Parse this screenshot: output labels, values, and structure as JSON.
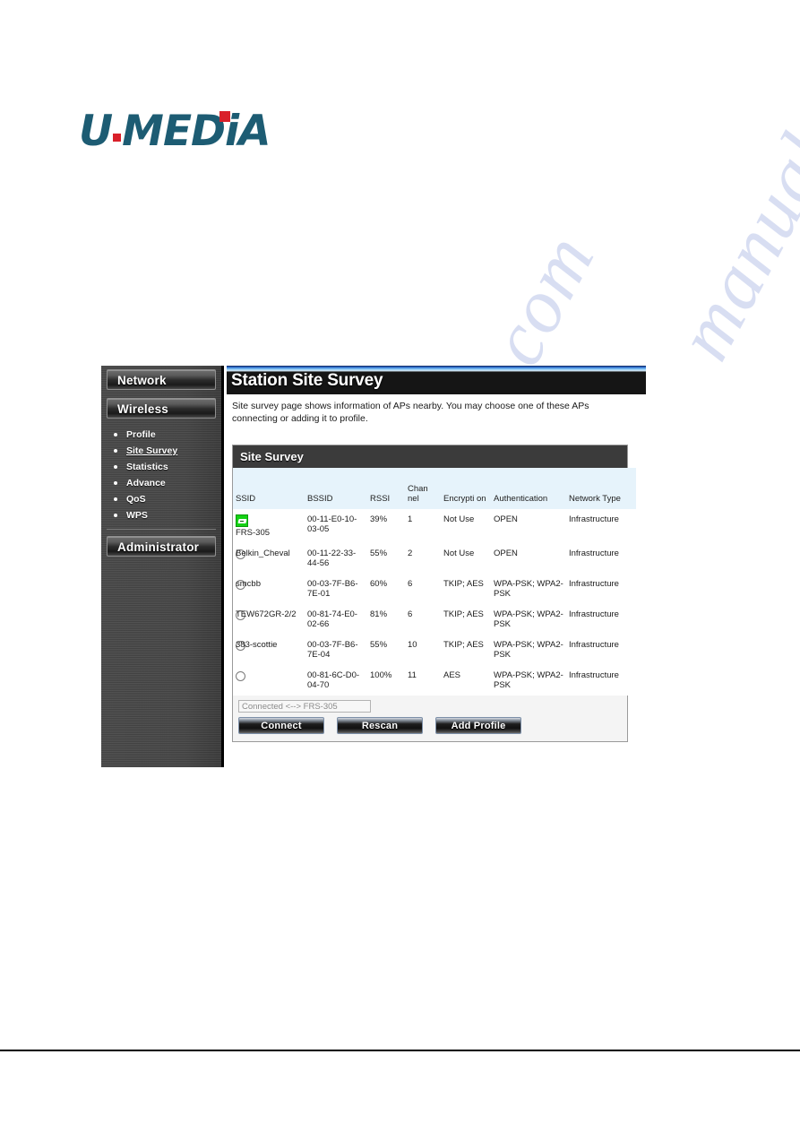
{
  "logo": {
    "part1": "U",
    "part2": "MEDiA",
    "alt": "U-MEDIA"
  },
  "sidebar": {
    "sections": [
      {
        "label": "Network"
      },
      {
        "label": "Wireless"
      },
      {
        "label": "Administrator"
      }
    ],
    "wireless_items": [
      {
        "label": "Profile",
        "active": false
      },
      {
        "label": "Site Survey",
        "active": true
      },
      {
        "label": "Statistics",
        "active": false
      },
      {
        "label": "Advance",
        "active": false
      },
      {
        "label": "QoS",
        "active": false
      },
      {
        "label": "WPS",
        "active": false
      }
    ]
  },
  "page": {
    "title": "Station Site Survey",
    "description": "Site survey page shows information of APs nearby. You may choose one of these APs connecting or adding it to profile."
  },
  "panel": {
    "title": "Site Survey"
  },
  "table": {
    "headers": {
      "ssid": "SSID",
      "bssid": "BSSID",
      "rssi": "RSSI",
      "channel": "Chan nel",
      "encryption": "Encrypti on",
      "authentication": "Authentication",
      "network_type": "Network Type"
    },
    "rows": [
      {
        "selected": false,
        "connected": true,
        "ssid": "FRS-305",
        "bssid": "00-11-E0-10-03-05",
        "rssi": "39%",
        "channel": "1",
        "encryption": "Not Use",
        "authentication": "OPEN",
        "network_type": "Infrastructure"
      },
      {
        "selected": false,
        "connected": false,
        "ssid": "Belkin_Cheval",
        "bssid": "00-11-22-33-44-56",
        "rssi": "55%",
        "channel": "2",
        "encryption": "Not Use",
        "authentication": "OPEN",
        "network_type": "Infrastructure"
      },
      {
        "selected": false,
        "connected": false,
        "ssid": "smcbb",
        "bssid": "00-03-7F-B6-7E-01",
        "rssi": "60%",
        "channel": "6",
        "encryption": "TKIP; AES",
        "authentication": "WPA-PSK; WPA2-PSK",
        "network_type": "Infrastructure"
      },
      {
        "selected": false,
        "connected": false,
        "ssid": "TEW672GR-2/2",
        "bssid": "00-81-74-E0-02-66",
        "rssi": "81%",
        "channel": "6",
        "encryption": "TKIP; AES",
        "authentication": "WPA-PSK; WPA2-PSK",
        "network_type": "Infrastructure"
      },
      {
        "selected": false,
        "connected": false,
        "ssid": "383-scottie",
        "bssid": "00-03-7F-B6-7E-04",
        "rssi": "55%",
        "channel": "10",
        "encryption": "TKIP; AES",
        "authentication": "WPA-PSK; WPA2-PSK",
        "network_type": "Infrastructure"
      },
      {
        "selected": false,
        "connected": false,
        "ssid": "",
        "bssid": "00-81-6C-D0-04-70",
        "rssi": "100%",
        "channel": "11",
        "encryption": "AES",
        "authentication": "WPA-PSK; WPA2-PSK",
        "network_type": "Infrastructure"
      }
    ]
  },
  "status": {
    "value": "Connected <--> FRS-305"
  },
  "buttons": {
    "connect": "Connect",
    "rescan": "Rescan",
    "add_profile": "Add Profile"
  },
  "watermark": {
    "text": "manualshive.com"
  }
}
